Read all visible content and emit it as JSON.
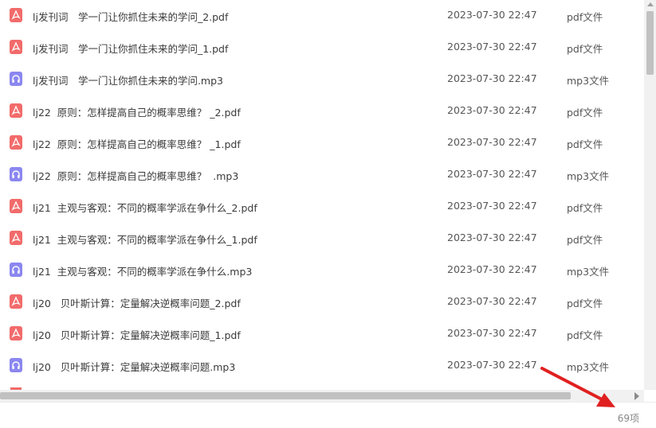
{
  "files": [
    {
      "name": "lj发刊词　学一门让你抓住未来的学问_2.pdf",
      "date": "2023-07-30 22:47",
      "type": "pdf文件",
      "icon": "pdf-icon"
    },
    {
      "name": "lj发刊词　学一门让你抓住未来的学问_1.pdf",
      "date": "2023-07-30 22:47",
      "type": "pdf文件",
      "icon": "pdf-icon"
    },
    {
      "name": "lj发刊词　学一门让你抓住未来的学问.mp3",
      "date": "2023-07-30 22:47",
      "type": "mp3文件",
      "icon": "audio-icon"
    },
    {
      "name": "lj22  原则：怎样提高自己的概率思维？ _2.pdf",
      "date": "2023-07-30 22:47",
      "type": "pdf文件",
      "icon": "pdf-icon"
    },
    {
      "name": "lj22  原则：怎样提高自己的概率思维？ _1.pdf",
      "date": "2023-07-30 22:47",
      "type": "pdf文件",
      "icon": "pdf-icon"
    },
    {
      "name": "lj22  原则：怎样提高自己的概率思维？  .mp3",
      "date": "2023-07-30 22:47",
      "type": "mp3文件",
      "icon": "audio-icon"
    },
    {
      "name": "lj21  主观与客观：不同的概率学派在争什么_2.pdf",
      "date": "2023-07-30 22:47",
      "type": "pdf文件",
      "icon": "pdf-icon"
    },
    {
      "name": "lj21  主观与客观：不同的概率学派在争什么_1.pdf",
      "date": "2023-07-30 22:47",
      "type": "pdf文件",
      "icon": "pdf-icon"
    },
    {
      "name": "lj21  主观与客观：不同的概率学派在争什么.mp3",
      "date": "2023-07-30 22:47",
      "type": "mp3文件",
      "icon": "audio-icon"
    },
    {
      "name": "lj20   贝叶斯计算：定量解决逆概率问题_2.pdf",
      "date": "2023-07-30 22:47",
      "type": "pdf文件",
      "icon": "pdf-icon"
    },
    {
      "name": "lj20   贝叶斯计算：定量解决逆概率问题_1.pdf",
      "date": "2023-07-30 22:47",
      "type": "pdf文件",
      "icon": "pdf-icon"
    },
    {
      "name": "lj20   贝叶斯计算：定量解决逆概率问题.mp3",
      "date": "2023-07-30 22:47",
      "type": "mp3文件",
      "icon": "audio-icon"
    }
  ],
  "footer": {
    "count": "69项"
  },
  "colors": {
    "pdf": "#f26b6b",
    "audio": "#8b87f0",
    "arrow": "#e02020"
  }
}
